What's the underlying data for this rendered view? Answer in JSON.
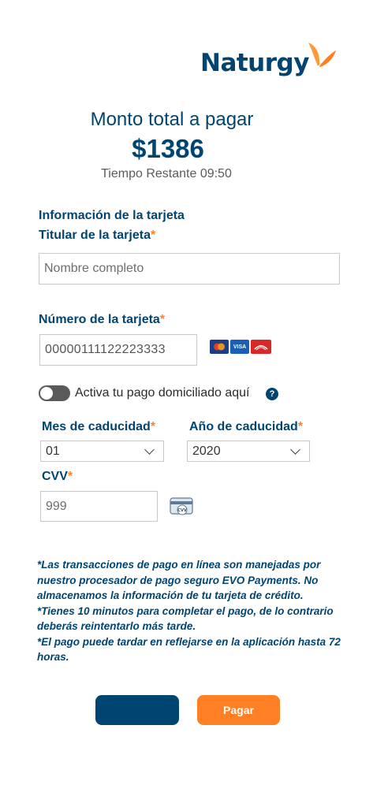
{
  "brand": {
    "name": "Naturgy",
    "logo_icon": "butterfly-logo-icon",
    "color_primary": "#004571",
    "color_accent": "#ff7f24"
  },
  "header": {
    "title": "Monto total a pagar",
    "amount": "$1386",
    "timer": "Tiempo Restante 09:50"
  },
  "form": {
    "section_title": "Información de la tarjeta",
    "holder_label": "Titular de la tarjeta",
    "holder_placeholder": "Nombre completo",
    "required_mark": "*",
    "card_number_label": "Número de la tarjeta",
    "card_number_value": "00000111122223333",
    "card_brands": [
      "MC",
      "VISA",
      "CARNET"
    ],
    "autopay_label": "Activa tu pago domiciliado aquí",
    "autopay_enabled": false,
    "help_glyph": "?",
    "month_label": "Mes de caducidad",
    "month_value": "01",
    "year_label": "Año de caducidad",
    "year_value": "2020",
    "cvv_label": "CVV",
    "cvv_placeholder": "999",
    "cvv_icon_text": "CVV"
  },
  "notes": [
    "*Las transacciones de pago en línea son manejadas por nuestro procesador de pago seguro EVO Payments. No almacenamos la información de tu tarjeta de crédito.",
    "*Tienes 10 minutos para completar el pago, de lo contrario deberás reintentarlo más tarde.",
    "*El pago puede tardar en reflejarse en la aplicación hasta 72 horas."
  ],
  "actions": {
    "back_label": "",
    "pay_label": "Pagar"
  }
}
